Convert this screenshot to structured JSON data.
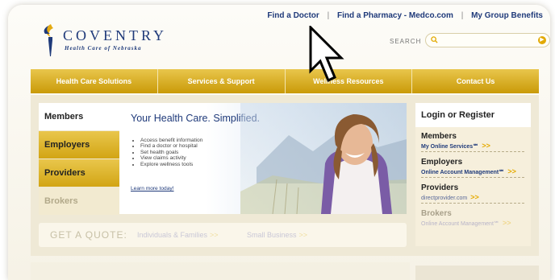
{
  "utility_nav": {
    "find_doctor": "Find a Doctor",
    "find_pharmacy": "Find a Pharmacy - Medco.com",
    "group_benefits": "My Group Benefits",
    "separator": "|"
  },
  "brand": {
    "name": "COVENTRY",
    "tagline": "Health Care of Nebraska",
    "logo_icon": "torch-logo-icon"
  },
  "search": {
    "label": "SEARCH",
    "placeholder": "",
    "go_icon": "go-arrow-icon"
  },
  "main_nav": {
    "items": [
      "Health Care Solutions",
      "Services & Support",
      "Wellness Resources",
      "Contact Us"
    ]
  },
  "audience_tabs": [
    "Members",
    "Employers",
    "Providers",
    "Brokers"
  ],
  "hero": {
    "title": "Your Health Care. Simplified.",
    "bullets": [
      "Access benefit information",
      "Find a doctor or hospital",
      "Set health goals",
      "View claims activity",
      "Explore wellness tools"
    ],
    "learn_more": "Learn more today!"
  },
  "quote": {
    "label": "GET A QUOTE:",
    "individuals": "Individuals & Families",
    "small_business": "Small Business",
    "arrow": ">>"
  },
  "login": {
    "title": "Login or Register",
    "sections": [
      {
        "head": "Members",
        "link": "My Online Services℠"
      },
      {
        "head": "Employers",
        "link": "Online Account Management℠"
      },
      {
        "head": "Providers",
        "link": "directprovider.com"
      },
      {
        "head": "Brokers",
        "link": "Online Account Management℠"
      }
    ],
    "arrow": ">>"
  },
  "colors": {
    "nav_gold": "#d4a818",
    "brand_blue": "#1f3a7a",
    "arrow_orange": "#e5aa00"
  }
}
